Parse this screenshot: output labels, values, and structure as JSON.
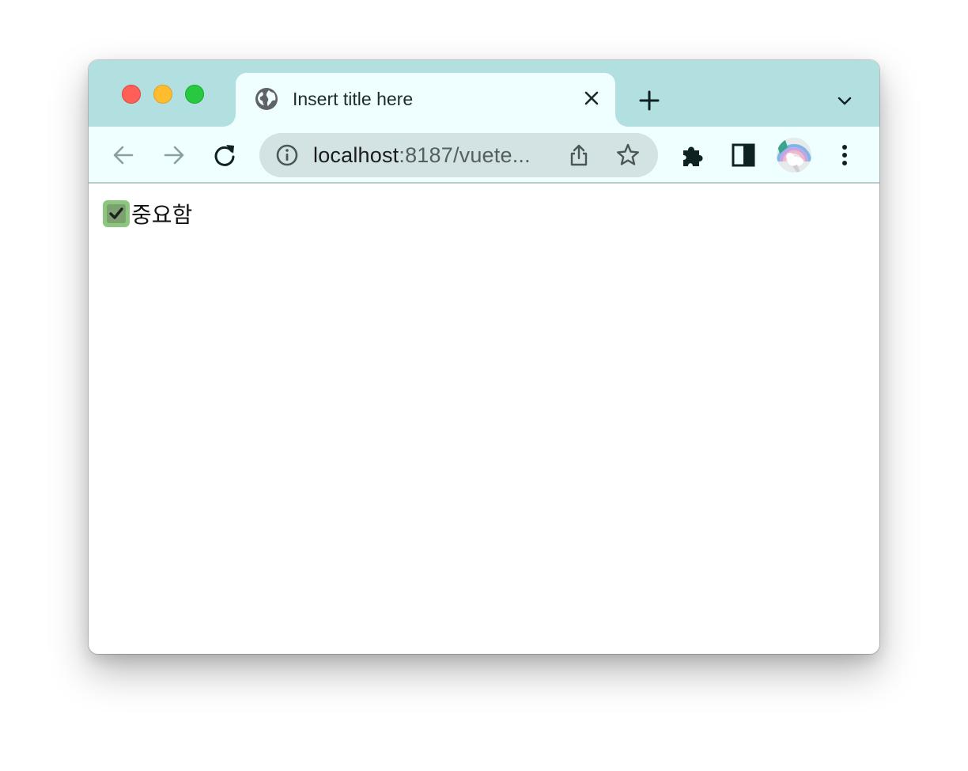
{
  "window": {
    "controls": [
      "close",
      "minimize",
      "zoom"
    ]
  },
  "tab": {
    "title": "Insert title here",
    "favicon": "globe-icon"
  },
  "toolbar": {
    "url_host": "localhost",
    "url_rest": ":8187/vuete...",
    "icons": [
      "back-arrow-icon",
      "forward-arrow-icon",
      "reload-icon",
      "info-icon",
      "share-icon",
      "star-icon",
      "puzzle-icon",
      "sidepanel-icon",
      "avatar",
      "kebab-menu-icon"
    ]
  },
  "content": {
    "checkbox_checked": true,
    "checkbox_label": "중요함"
  },
  "colors": {
    "tabstrip": "#b2dfdf",
    "toolbar": "#effefe",
    "omnibox": "#d3e3e3",
    "checkbox": "#8dc77f"
  }
}
